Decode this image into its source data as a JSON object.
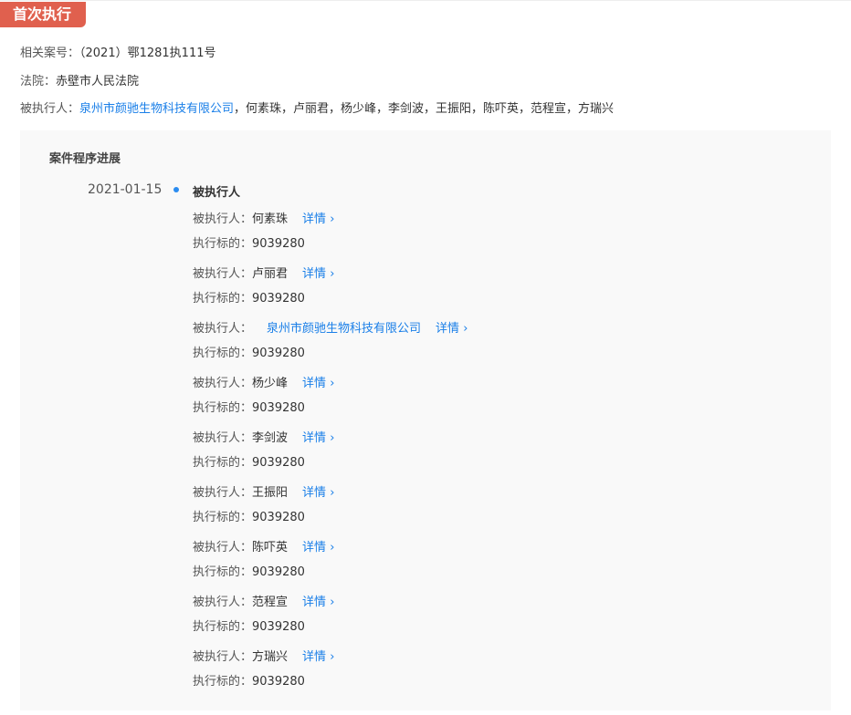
{
  "tag": "首次执行",
  "case_no": {
    "label": "相关案号：",
    "value": "（2021）鄂1281执111号"
  },
  "court": {
    "label": "法院：",
    "value": "赤壁市人民法院"
  },
  "executed": {
    "label": "被执行人：",
    "company": "泉州市颜驰生物科技有限公司",
    "others": "，何素珠，卢丽君，杨少峰，李剑波，王振阳，陈吓英，范程宣，方瑞兴"
  },
  "progress": {
    "title": "案件程序进展",
    "date": "2021-01-15",
    "event": "被执行人",
    "person_label": "被执行人：",
    "target_label": "执行标的：",
    "detail_label": "详情",
    "entries": [
      {
        "name": "何素珠",
        "amount": "9039280",
        "link": false
      },
      {
        "name": "卢丽君",
        "amount": "9039280",
        "link": false
      },
      {
        "name": "泉州市颜驰生物科技有限公司",
        "amount": "9039280",
        "link": true
      },
      {
        "name": "杨少峰",
        "amount": "9039280",
        "link": false
      },
      {
        "name": "李剑波",
        "amount": "9039280",
        "link": false
      },
      {
        "name": "王振阳",
        "amount": "9039280",
        "link": false
      },
      {
        "name": "陈吓英",
        "amount": "9039280",
        "link": false
      },
      {
        "name": "范程宣",
        "amount": "9039280",
        "link": false
      },
      {
        "name": "方瑞兴",
        "amount": "9039280",
        "link": false
      }
    ]
  }
}
